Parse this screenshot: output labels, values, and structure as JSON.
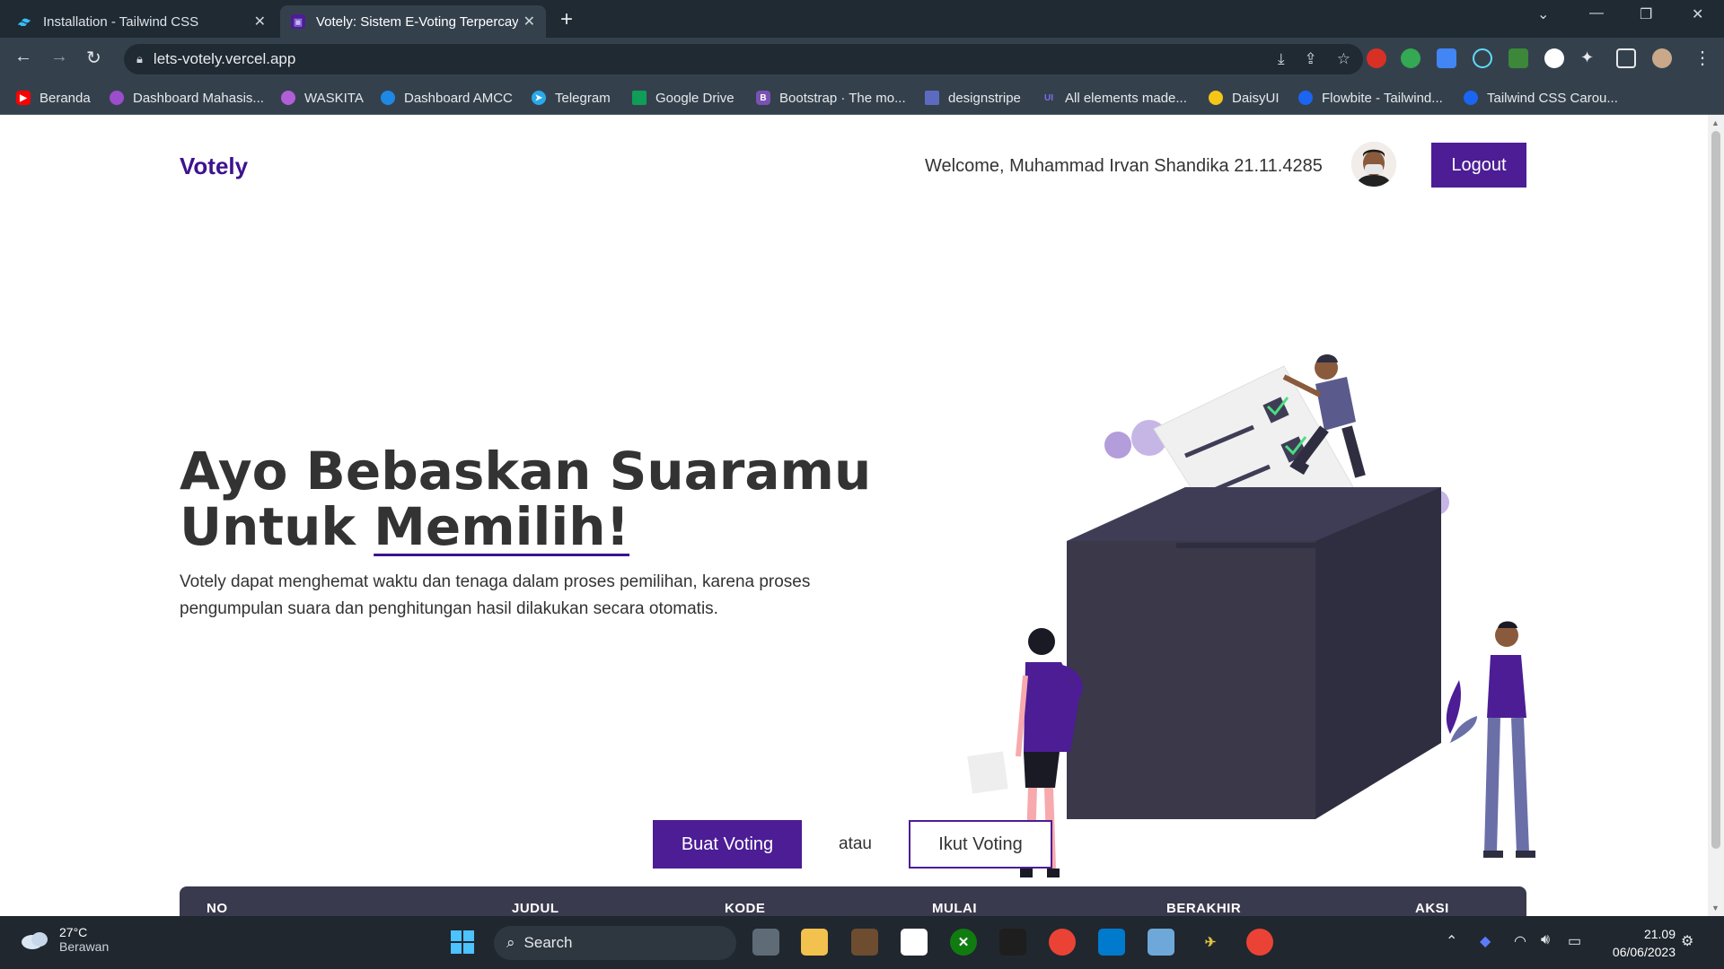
{
  "browser": {
    "tabs": [
      {
        "title": "Installation - Tailwind CSS",
        "icon": "tailwind-icon"
      },
      {
        "title": "Votely: Sistem E-Voting Terpercaya",
        "icon": "votely-icon"
      }
    ],
    "url": "lets-votely.vercel.app",
    "bookmarks": [
      "Beranda",
      "Dashboard Mahasis...",
      "WASKITA",
      "Dashboard AMCC",
      "Telegram",
      "Google Drive",
      "Bootstrap · The mo...",
      "designstripe",
      "All elements made...",
      "DaisyUI",
      "Flowbite - Tailwind...",
      "Tailwind CSS Carou..."
    ]
  },
  "header": {
    "brand": "Votely",
    "welcome": "Welcome, Muhammad Irvan Shandika 21.11.4285",
    "logout": "Logout"
  },
  "hero": {
    "title_line1": "Ayo Bebaskan Suaramu",
    "title_line2_a": "Untuk ",
    "title_line2_b": "Memilih!",
    "description": "Votely dapat menghemat waktu dan tenaga dalam proses pemilihan, karena proses pengumpulan suara dan penghitungan hasil dilakukan secara otomatis."
  },
  "actions": {
    "create": "Buat Voting",
    "or": "atau",
    "join": "Ikut Voting"
  },
  "table": {
    "headers": [
      "NO",
      "JUDUL",
      "KODE",
      "MULAI",
      "BERAKHIR",
      "AKSI"
    ]
  },
  "taskbar": {
    "weather_temp": "27°C",
    "weather_desc": "Berawan",
    "search": "Search",
    "time": "21.09",
    "date": "06/06/2023"
  },
  "colors": {
    "primary": "#4c1d95",
    "brand": "#3d128f",
    "table_head": "#3a3a4e"
  }
}
